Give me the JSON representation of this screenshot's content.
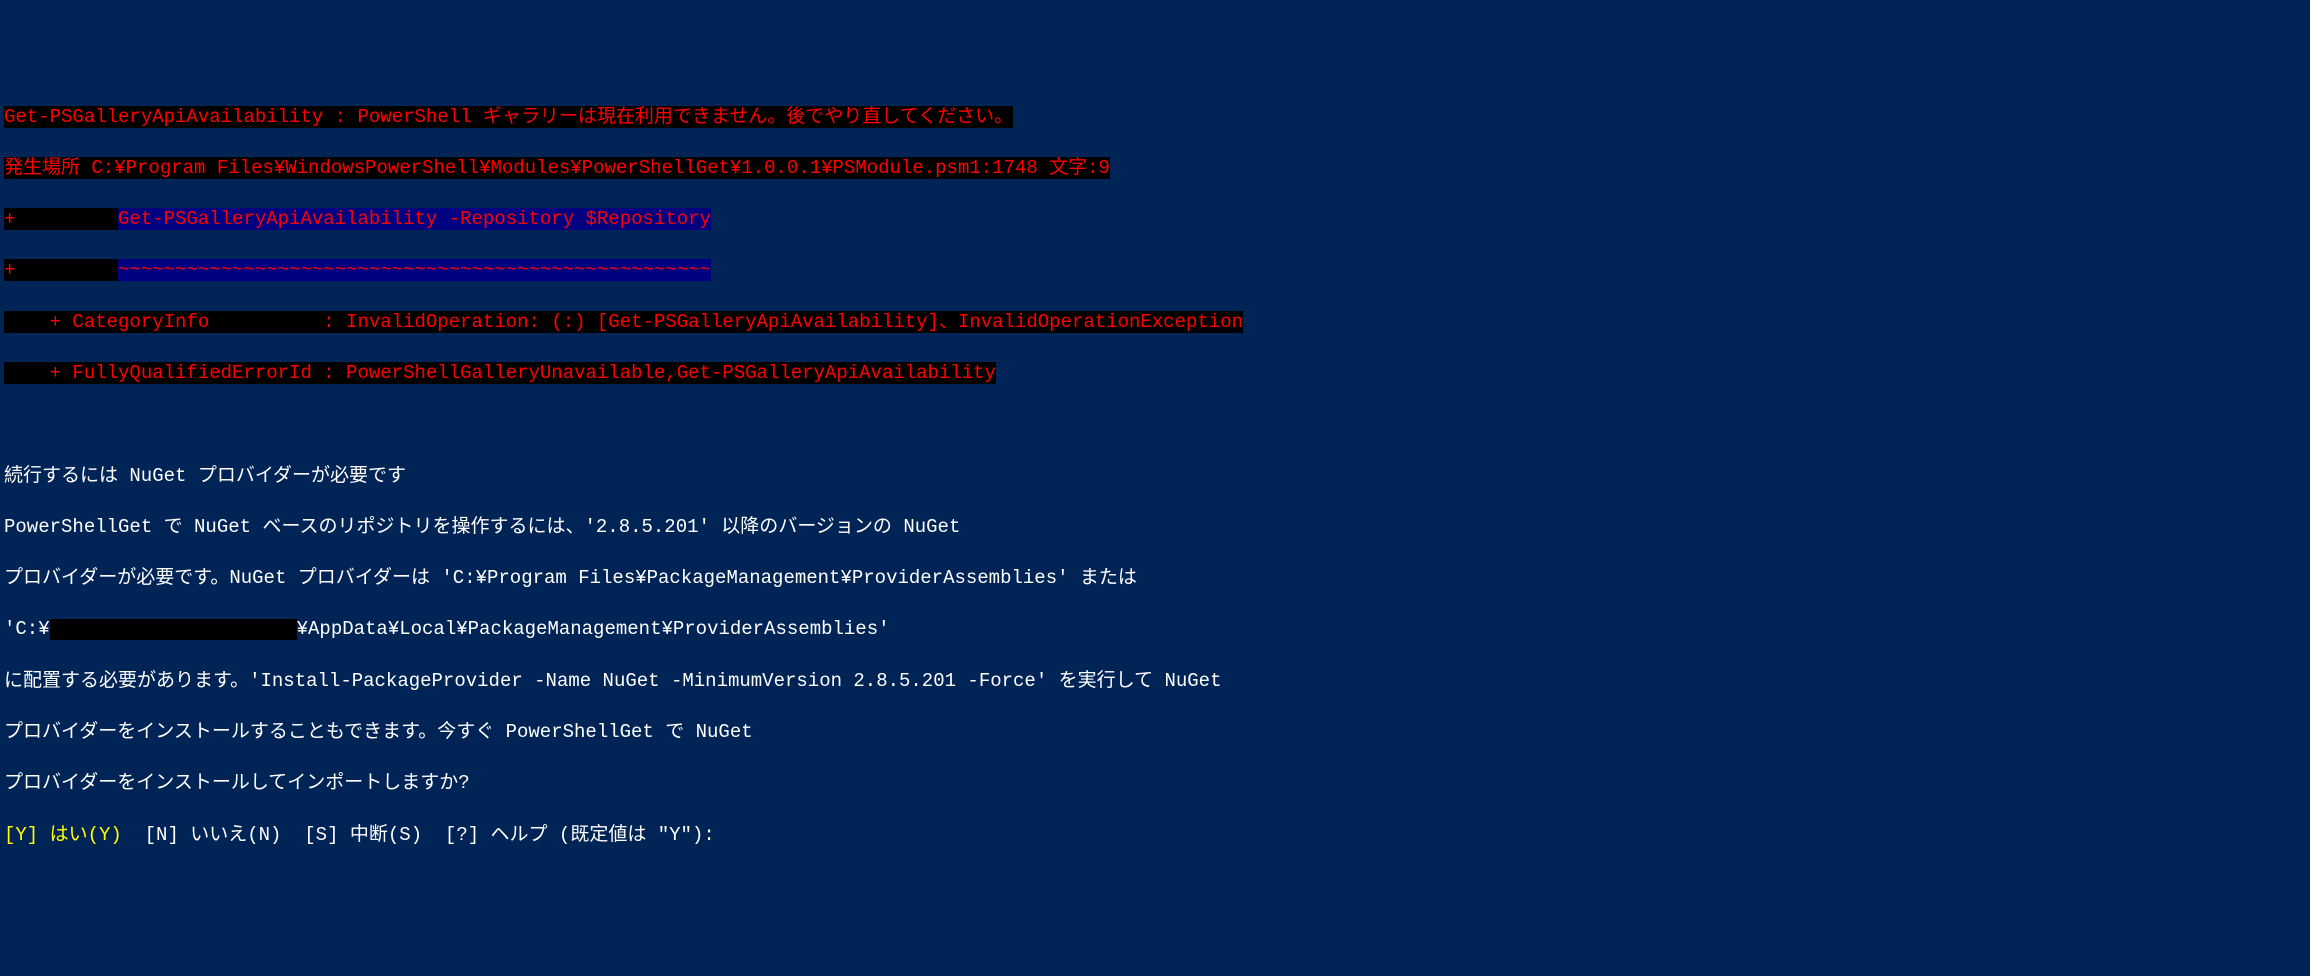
{
  "error": {
    "line1": "Get-PSGalleryApiAvailability : PowerShell ギャラリーは現在利用できません。後でやり直してください。",
    "line2": "発生場所 C:¥Program Files¥WindowsPowerShell¥Modules¥PowerShellGet¥1.0.0.1¥PSModule.psm1:1748 文字:9",
    "line3_prefix": "+         ",
    "line3_cmd": "Get-PSGalleryApiAvailability -Repository $Repository",
    "line4_prefix": "+         ",
    "line4_underline": "~~~~~~~~~~~~~~~~~~~~~~~~~~~~~~~~~~~~~~~~~~~~~~~~~~~~",
    "line5": "    + CategoryInfo          : InvalidOperation: (:) [Get-PSGalleryApiAvailability]、InvalidOperationException",
    "line6": "    + FullyQualifiedErrorId : PowerShellGalleryUnavailable,Get-PSGalleryApiAvailability"
  },
  "blank": "",
  "info": {
    "title": "続行するには NuGet プロバイダーが必要です",
    "line1": "PowerShellGet で NuGet ベースのリポジトリを操作するには、'2.8.5.201' 以降のバージョンの NuGet",
    "line2": "プロバイダーが必要です。NuGet プロバイダーは 'C:¥Program Files¥PackageManagement¥ProviderAssemblies' または",
    "line3_prefix": "'C:¥",
    "line3_suffix": "¥AppData¥Local¥PackageManagement¥ProviderAssemblies'",
    "line4": "に配置する必要があります。'Install-PackageProvider -Name NuGet -MinimumVersion 2.8.5.201 -Force' を実行して NuGet",
    "line5": "プロバイダーをインストールすることもできます。今すぐ PowerShellGet で NuGet",
    "line6": "プロバイダーをインストールしてインポートしますか?"
  },
  "prompt": {
    "yes_key": "[Y] はい(Y)",
    "sep1": "  ",
    "no": "[N] いいえ(N)",
    "sep2": "  ",
    "suspend": "[S] 中断(S)",
    "sep3": "  ",
    "help": "[?] ヘルプ (既定値は \"Y\"): "
  }
}
